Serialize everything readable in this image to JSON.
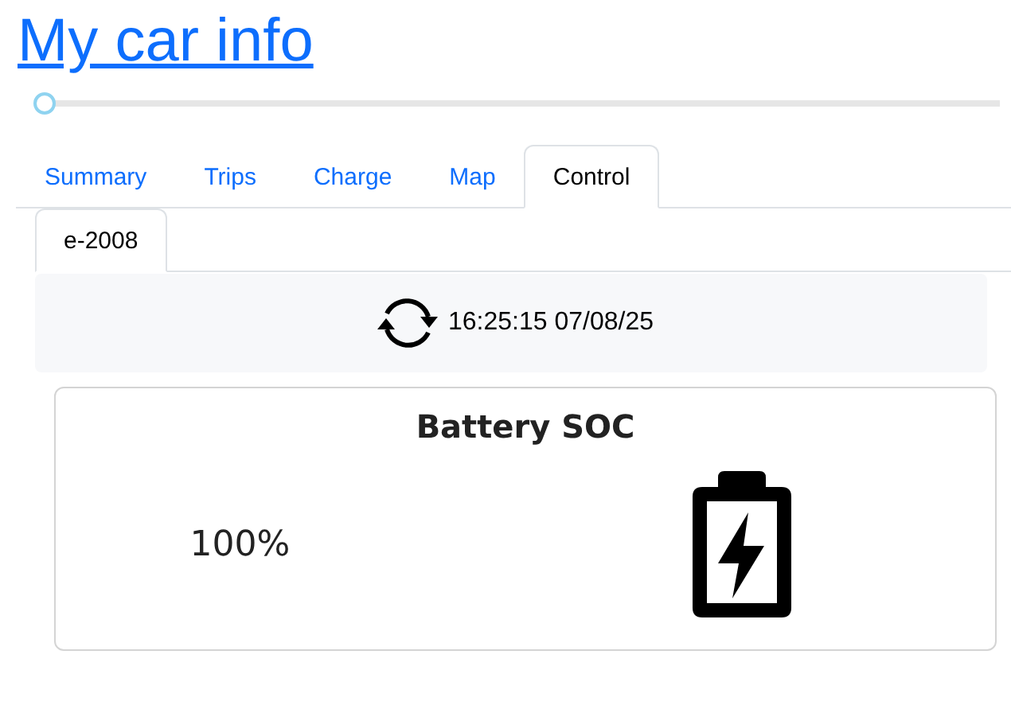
{
  "title": "My car info",
  "slider": {
    "level": 0
  },
  "tabs": [
    {
      "label": "Summary",
      "selected": false
    },
    {
      "label": "Trips",
      "selected": false
    },
    {
      "label": "Charge",
      "selected": false
    },
    {
      "label": "Map",
      "selected": false
    },
    {
      "label": "Control",
      "selected": true
    }
  ],
  "vehicle_tabs": [
    {
      "label": "e-2008",
      "selected": true
    }
  ],
  "refresh": {
    "timestamp": "16:25:15 07/08/25"
  },
  "battery_card": {
    "title": "Battery SOC",
    "value": "100%"
  }
}
